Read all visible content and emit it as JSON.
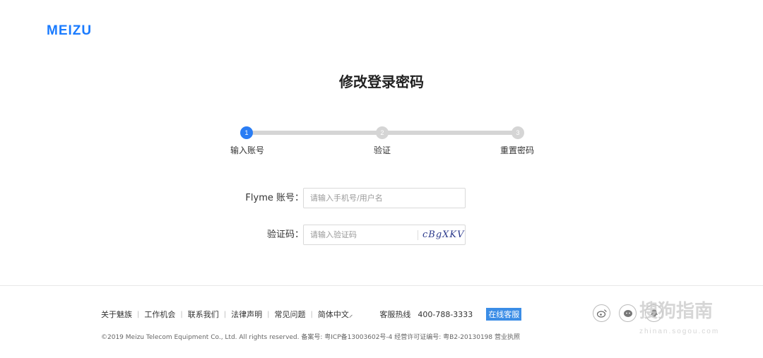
{
  "brand": {
    "logo_text": "MEIZU",
    "color": "#1a7bff"
  },
  "page": {
    "title": "修改登录密码"
  },
  "steps": [
    {
      "num": "1",
      "label": "输入账号",
      "active": true
    },
    {
      "num": "2",
      "label": "验证",
      "active": false
    },
    {
      "num": "3",
      "label": "重置密码",
      "active": false
    }
  ],
  "form": {
    "account": {
      "label": "Flyme 账号：",
      "placeholder": "请输入手机号/用户名",
      "value": ""
    },
    "captcha": {
      "label": "验证码：",
      "placeholder": "请输入验证码",
      "value": "",
      "image_text": "cBgXKV"
    }
  },
  "footer": {
    "links": [
      "关于魅族",
      "工作机会",
      "联系我们",
      "法律声明",
      "常见问题",
      "简体中文"
    ],
    "language_suffix": "⸝",
    "hotline_label": "客服热线",
    "hotline_number": "400-788-3333",
    "online_service": "在线客服",
    "copyright": "©2019 Meizu Telecom Equipment Co., Ltd. All rights reserved.  备案号: 粤ICP备13003602号-4  经营许可证编号: 粤B2-20130198  营业执照",
    "social_icons": [
      "weibo-icon",
      "wechat-icon",
      "qq-icon"
    ]
  },
  "watermark": {
    "text": "搜狗指南",
    "sub": "zhinan.sogou.com"
  },
  "colors": {
    "accent": "#2a7df4",
    "inactive": "#d5d5d5",
    "online_bg": "#3b8de6"
  }
}
